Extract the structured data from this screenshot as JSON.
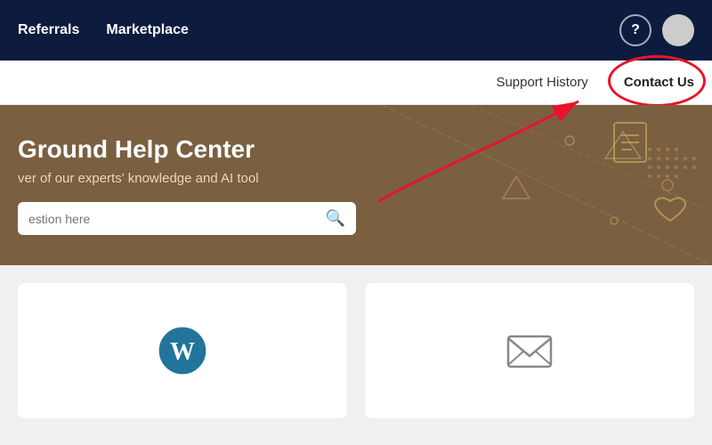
{
  "topNav": {
    "links": [
      {
        "label": "Referrals",
        "id": "referrals"
      },
      {
        "label": "Marketplace",
        "id": "marketplace"
      }
    ],
    "helpLabel": "?",
    "colors": {
      "bg": "#0d1b3e"
    }
  },
  "subNav": {
    "links": [
      {
        "label": "Support History",
        "id": "support-history",
        "active": false
      },
      {
        "label": "Contact Us",
        "id": "contact-us",
        "active": true
      }
    ]
  },
  "hero": {
    "title": "Ground Help Center",
    "subtitle": "ver of our experts' knowledge and AI tool",
    "searchPlaceholder": "estion here",
    "bgColor": "#7a6040"
  },
  "cards": [
    {
      "id": "wordpress",
      "iconType": "wordpress"
    },
    {
      "id": "email",
      "iconType": "envelope"
    }
  ]
}
